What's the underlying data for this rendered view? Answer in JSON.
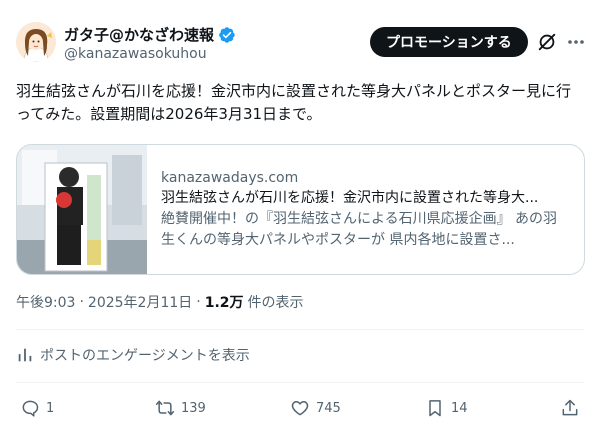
{
  "author": {
    "display_name": "ガタ子@かなざわ速報",
    "handle": "@kanazawasokuhou",
    "verified": true
  },
  "header": {
    "promo_label": "プロモーションする",
    "grok_icon": "grok-slash-icon",
    "more_icon": "more-icon"
  },
  "tweet": {
    "text": "羽生結弦さんが石川を応援！金沢市内に設置された等身大パネルとポスター見に行ってみた。設置期間は2026年3月31日まで。"
  },
  "card": {
    "domain": "kanazawadays.com",
    "title": "羽生結弦さんが石川を応援！金沢市内に設置された等身大...",
    "description": "絶賛開催中！の『羽生結弦さんによる石川県応援企画』 あの羽生くんの等身大パネルやポスターが 県内各地に設置さ..."
  },
  "meta": {
    "time": "午後9:03",
    "date": "2025年2月11日",
    "separator": "·",
    "views_count": "1.2万",
    "views_label": "件の表示"
  },
  "engagement": {
    "label": "ポストのエンゲージメントを表示",
    "icon": "analytics-icon"
  },
  "actions": {
    "replies": "1",
    "reposts": "139",
    "likes": "745",
    "bookmarks": "14"
  },
  "colors": {
    "text": "#0f1419",
    "secondary": "#536471",
    "border": "#cfd9de",
    "verified": "#1d9bf0",
    "button_bg": "#0f1419"
  }
}
